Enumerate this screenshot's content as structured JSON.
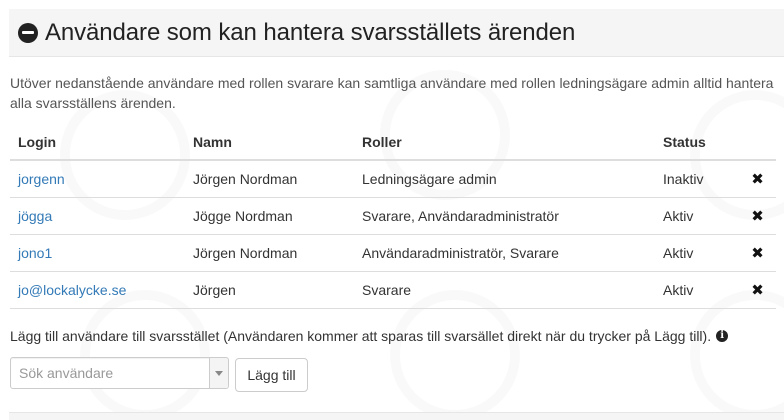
{
  "panel": {
    "title": "Användare som kan hantera svarsställets ärenden",
    "collapse_icon": "minus-circle-icon"
  },
  "info_text": "Utöver nedanstående användare med rollen svarare kan samtliga användare med rollen ledningsägare admin alltid hantera alla svarsställens ärenden.",
  "table": {
    "headers": {
      "login": "Login",
      "name": "Namn",
      "roles": "Roller",
      "status": "Status"
    },
    "rows": [
      {
        "login": "jorgenn",
        "name": "Jörgen Nordman",
        "roles": "Ledningsägare admin",
        "status": "Inaktiv",
        "remove_icon": "remove-icon"
      },
      {
        "login": "jögga",
        "name": "Jögge Nordman",
        "roles": "Svarare, Användaradministratör",
        "status": "Aktiv",
        "remove_icon": "remove-icon"
      },
      {
        "login": "jono1",
        "name": "Jörgen Nordman",
        "roles": "Användaradministratör, Svarare",
        "status": "Aktiv",
        "remove_icon": "remove-icon"
      },
      {
        "login": "jo@lockalycke.se",
        "name": "Jörgen",
        "roles": "Svarare",
        "status": "Aktiv",
        "remove_icon": "remove-icon"
      }
    ]
  },
  "add_user": {
    "hint": "Lägg till användare till svarsstället (Användaren kommer att sparas till svarsället direkt när du trycker på Lägg till).",
    "info_icon": "info-circle-icon",
    "search_placeholder": "Sök användare",
    "add_button_label": "Lägg till"
  },
  "colors": {
    "link": "#337ab7",
    "header_bg": "#f5f5f5",
    "border": "#dddddd"
  }
}
